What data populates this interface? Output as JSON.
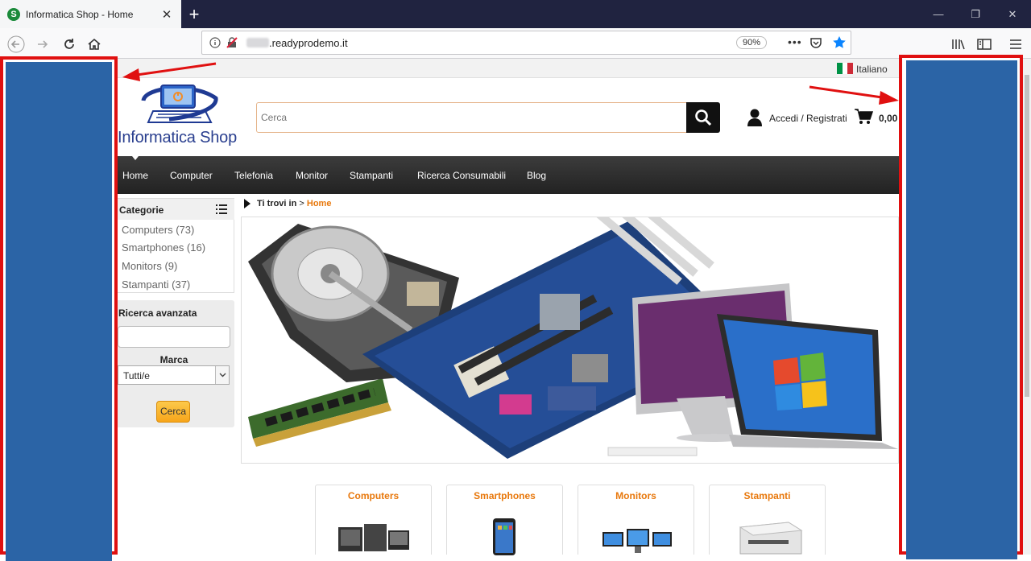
{
  "browser": {
    "tab_title": "Informatica Shop - Home",
    "url_text": ".readyprodemo.it",
    "zoom": "90%"
  },
  "header": {
    "language": "Italiano",
    "logo_text": "Informatica Shop",
    "search_placeholder": "Cerca",
    "account_label": "Accedi / Registrati",
    "cart_total": "0,00"
  },
  "nav": {
    "items": [
      "Home",
      "Computer",
      "Telefonia",
      "Monitor",
      "Stampanti",
      "Ricerca Consumabili",
      "Blog"
    ]
  },
  "sidebar": {
    "categories_title": "Categorie",
    "categories": [
      "Computers (73)",
      "Smartphones (16)",
      "Monitors (9)",
      "Stampanti (37)"
    ],
    "advanced_title": "Ricerca avanzata",
    "brand_label": "Marca",
    "brand_selected": "Tutti/e",
    "search_button": "Cerca"
  },
  "breadcrumb": {
    "prefix": "Ti trovi in",
    "separator": ">",
    "current": "Home"
  },
  "category_cards": [
    "Computers",
    "Smartphones",
    "Monitors",
    "Stampanti"
  ],
  "colors": {
    "overlay_blue": "#2b64a6",
    "highlight_red": "#e01010",
    "accent_orange": "#e8780c",
    "nav_dark": "#2a2a2a"
  }
}
